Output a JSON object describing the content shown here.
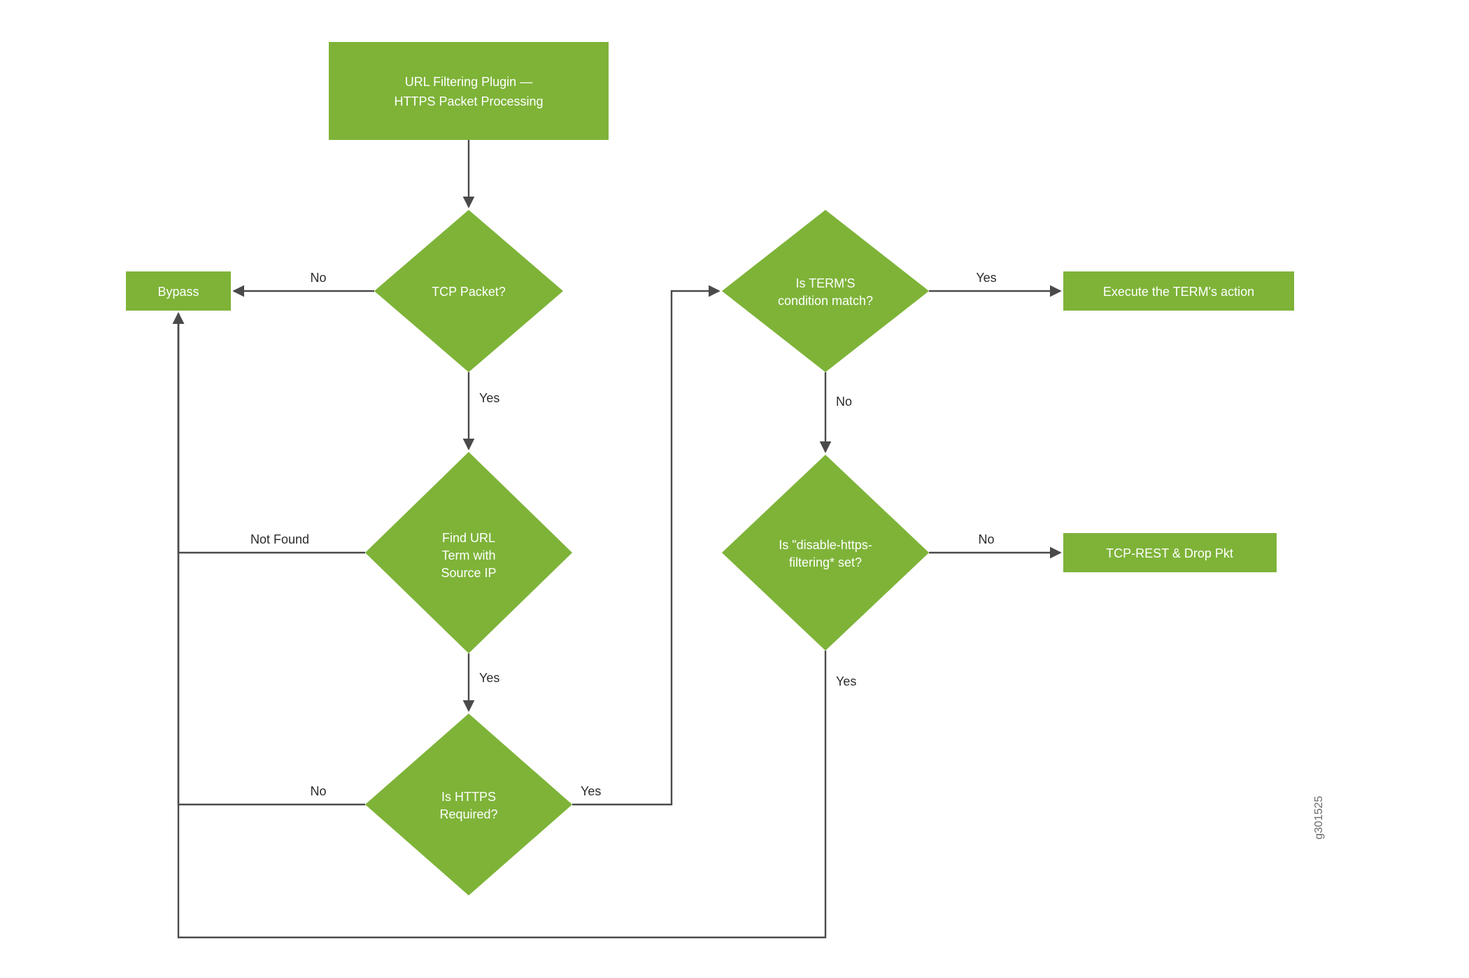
{
  "title_line1": "URL Filtering Plugin —",
  "title_line2": "HTTPS Packet Processing",
  "bypass": "Bypass",
  "tcp_packet": "TCP Packet?",
  "find_url_l1": "Find URL",
  "find_url_l2": "Term with",
  "find_url_l3": "Source IP",
  "https_req_l1": "Is HTTPS",
  "https_req_l2": "Required?",
  "term_cond_l1": "Is TERM'S",
  "term_cond_l2": "condition match?",
  "exec_term": "Execute the TERM's action",
  "dis_https_l1": "Is \"disable-https-",
  "dis_https_l2": "filtering* set?",
  "tcp_rest": "TCP-REST & Drop Pkt",
  "labels": {
    "no": "No",
    "yes": "Yes",
    "not_found": "Not Found"
  },
  "image_id": "g301525",
  "colors": {
    "shape": "#7eb338",
    "edge": "#4a4a4a"
  }
}
